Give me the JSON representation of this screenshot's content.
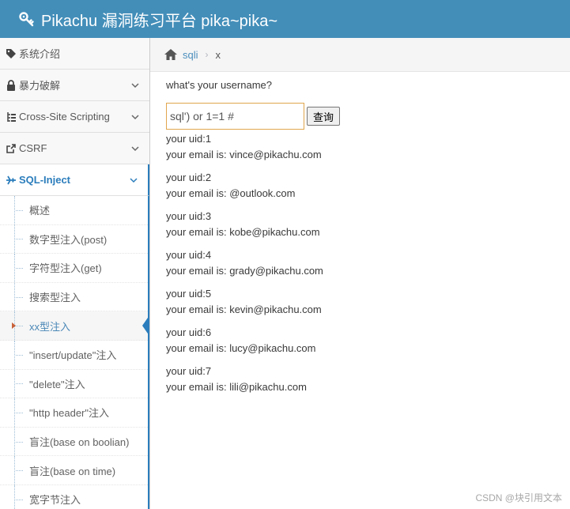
{
  "header": {
    "brand": "Pikachu 漏洞练习平台 pika~pika~"
  },
  "sidebar": {
    "items": [
      {
        "label": "系统介绍",
        "icon": "tags-icon",
        "has_chevron": false
      },
      {
        "label": "暴力破解",
        "icon": "lock-icon",
        "has_chevron": true
      },
      {
        "label": "Cross-Site Scripting",
        "icon": "list-tree-icon",
        "has_chevron": true
      },
      {
        "label": "CSRF",
        "icon": "share-icon",
        "has_chevron": true
      },
      {
        "label": "SQL-Inject",
        "icon": "plane-icon",
        "has_chevron": true
      }
    ],
    "submenu": [
      {
        "label": "概述"
      },
      {
        "label": "数字型注入(post)"
      },
      {
        "label": "字符型注入(get)"
      },
      {
        "label": "搜索型注入"
      },
      {
        "label": "xx型注入"
      },
      {
        "label": "\"insert/update\"注入"
      },
      {
        "label": "\"delete\"注入"
      },
      {
        "label": "\"http header\"注入"
      },
      {
        "label": "盲注(base on boolian)"
      },
      {
        "label": "盲注(base on time)"
      },
      {
        "label": "宽字节注入"
      }
    ]
  },
  "breadcrumb": {
    "link": "sqli",
    "current": "x"
  },
  "form": {
    "question": "what's your username?",
    "input_value": "sql') or 1=1 #",
    "submit_label": "查询"
  },
  "results": [
    {
      "uid": "your uid:1",
      "email": "your email is: vince@pikachu.com"
    },
    {
      "uid": "your uid:2",
      "email": "your email is: @outlook.com"
    },
    {
      "uid": "your uid:3",
      "email": "your email is: kobe@pikachu.com"
    },
    {
      "uid": "your uid:4",
      "email": "your email is: grady@pikachu.com"
    },
    {
      "uid": "your uid:5",
      "email": "your email is: kevin@pikachu.com"
    },
    {
      "uid": "your uid:6",
      "email": "your email is: lucy@pikachu.com"
    },
    {
      "uid": "your uid:7",
      "email": "your email is: lili@pikachu.com"
    }
  ],
  "watermark": "CSDN @块引用文本",
  "colors": {
    "navbar": "#438eb9",
    "accent": "#2b7dbc",
    "input_border": "#e0a64d"
  }
}
